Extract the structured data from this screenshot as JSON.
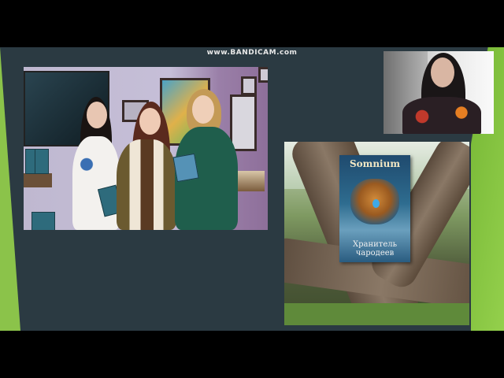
{
  "recorder": {
    "watermark": "www.BANDICAM.com"
  },
  "colors": {
    "slide_bg": "#2b3a42",
    "accent_green": "#8bc34a"
  },
  "slide": {
    "photo": {
      "description_icon": "group-photo-image"
    },
    "webcam": {
      "icon": "webcam-feed-image"
    },
    "book": {
      "title": "Somnium",
      "subtitle_line1": "Хранитель",
      "subtitle_line2": "чародеев",
      "icon": "book-cover-image"
    }
  }
}
